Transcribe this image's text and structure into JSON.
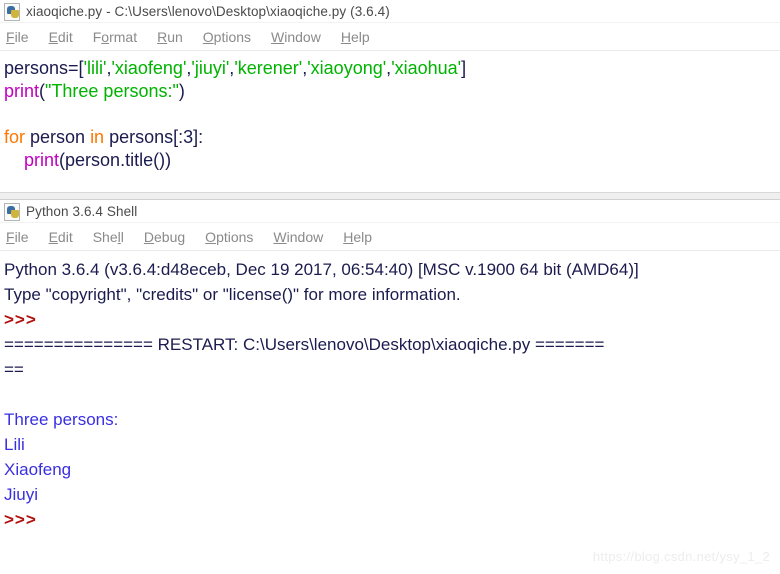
{
  "editor": {
    "title": "xiaoqiche.py - C:\\Users\\lenovo\\Desktop\\xiaoqiche.py (3.6.4)",
    "icon": "python-file-icon",
    "menus": [
      {
        "pre": "",
        "mn": "F",
        "post": "ile"
      },
      {
        "pre": "",
        "mn": "E",
        "post": "dit"
      },
      {
        "pre": "F",
        "mn": "o",
        "post": "rmat"
      },
      {
        "pre": "",
        "mn": "R",
        "post": "un"
      },
      {
        "pre": "",
        "mn": "O",
        "post": "ptions"
      },
      {
        "pre": "",
        "mn": "W",
        "post": "indow"
      },
      {
        "pre": "",
        "mn": "H",
        "post": "elp"
      }
    ],
    "code": [
      {
        "tokens": [
          {
            "t": "persons=[",
            "c": "plain"
          },
          {
            "t": "'lili'",
            "c": "string"
          },
          {
            "t": ",",
            "c": "plain"
          },
          {
            "t": "'xiaofeng'",
            "c": "string"
          },
          {
            "t": ",",
            "c": "plain"
          },
          {
            "t": "'jiuyi'",
            "c": "string"
          },
          {
            "t": ",",
            "c": "plain"
          },
          {
            "t": "'kerener'",
            "c": "string"
          },
          {
            "t": ",",
            "c": "plain"
          },
          {
            "t": "'xiaoyong'",
            "c": "string"
          },
          {
            "t": ",",
            "c": "plain"
          },
          {
            "t": "'xiaohua'",
            "c": "string"
          },
          {
            "t": "]",
            "c": "plain"
          }
        ]
      },
      {
        "tokens": [
          {
            "t": "print",
            "c": "builtin"
          },
          {
            "t": "(",
            "c": "plain"
          },
          {
            "t": "\"Three persons:\"",
            "c": "string"
          },
          {
            "t": ")",
            "c": "plain"
          }
        ]
      },
      {
        "tokens": []
      },
      {
        "tokens": [
          {
            "t": "for",
            "c": "keyword"
          },
          {
            "t": " person ",
            "c": "plain"
          },
          {
            "t": "in",
            "c": "keyword"
          },
          {
            "t": " persons[:3]:",
            "c": "plain"
          }
        ]
      },
      {
        "tokens": [
          {
            "t": "    ",
            "c": "plain"
          },
          {
            "t": "print",
            "c": "builtin"
          },
          {
            "t": "(person.title())",
            "c": "plain"
          }
        ]
      }
    ]
  },
  "shell": {
    "title": "Python 3.6.4 Shell",
    "icon": "python-file-icon",
    "menus": [
      {
        "pre": "",
        "mn": "F",
        "post": "ile"
      },
      {
        "pre": "",
        "mn": "E",
        "post": "dit"
      },
      {
        "pre": "She",
        "mn": "l",
        "post": "l"
      },
      {
        "pre": "",
        "mn": "D",
        "post": "ebug"
      },
      {
        "pre": "",
        "mn": "O",
        "post": "ptions"
      },
      {
        "pre": "",
        "mn": "W",
        "post": "indow"
      },
      {
        "pre": "",
        "mn": "H",
        "post": "elp"
      }
    ],
    "lines": [
      {
        "text": "Python 3.6.4 (v3.6.4:d48eceb, Dec 19 2017, 06:54:40) [MSC v.1900 64 bit (AMD64)]",
        "kind": "banner"
      },
      {
        "text": "Type \"copyright\", \"credits\" or \"license()\" for more information.",
        "kind": "banner"
      },
      {
        "text": ">>>",
        "kind": "prompt"
      },
      {
        "text": "=============== RESTART: C:\\Users\\lenovo\\Desktop\\xiaoqiche.py =======",
        "kind": "restart"
      },
      {
        "text": "==",
        "kind": "restart"
      },
      {
        "text": "",
        "kind": "blank"
      },
      {
        "text": "Three persons:",
        "kind": "output"
      },
      {
        "text": "Lili",
        "kind": "output"
      },
      {
        "text": "Xiaofeng",
        "kind": "output"
      },
      {
        "text": "Jiuyi",
        "kind": "output"
      },
      {
        "text": ">>>",
        "kind": "prompt"
      }
    ]
  },
  "watermark": {
    "text": "https://blog.csdn.net/ysy_1_2"
  },
  "colors": {
    "string": "#00b300",
    "builtin": "#c000c0",
    "keyword": "#ff7700",
    "plain": "#1b1b4f",
    "prompt": "#b01010",
    "output": "#3a2fe0"
  }
}
